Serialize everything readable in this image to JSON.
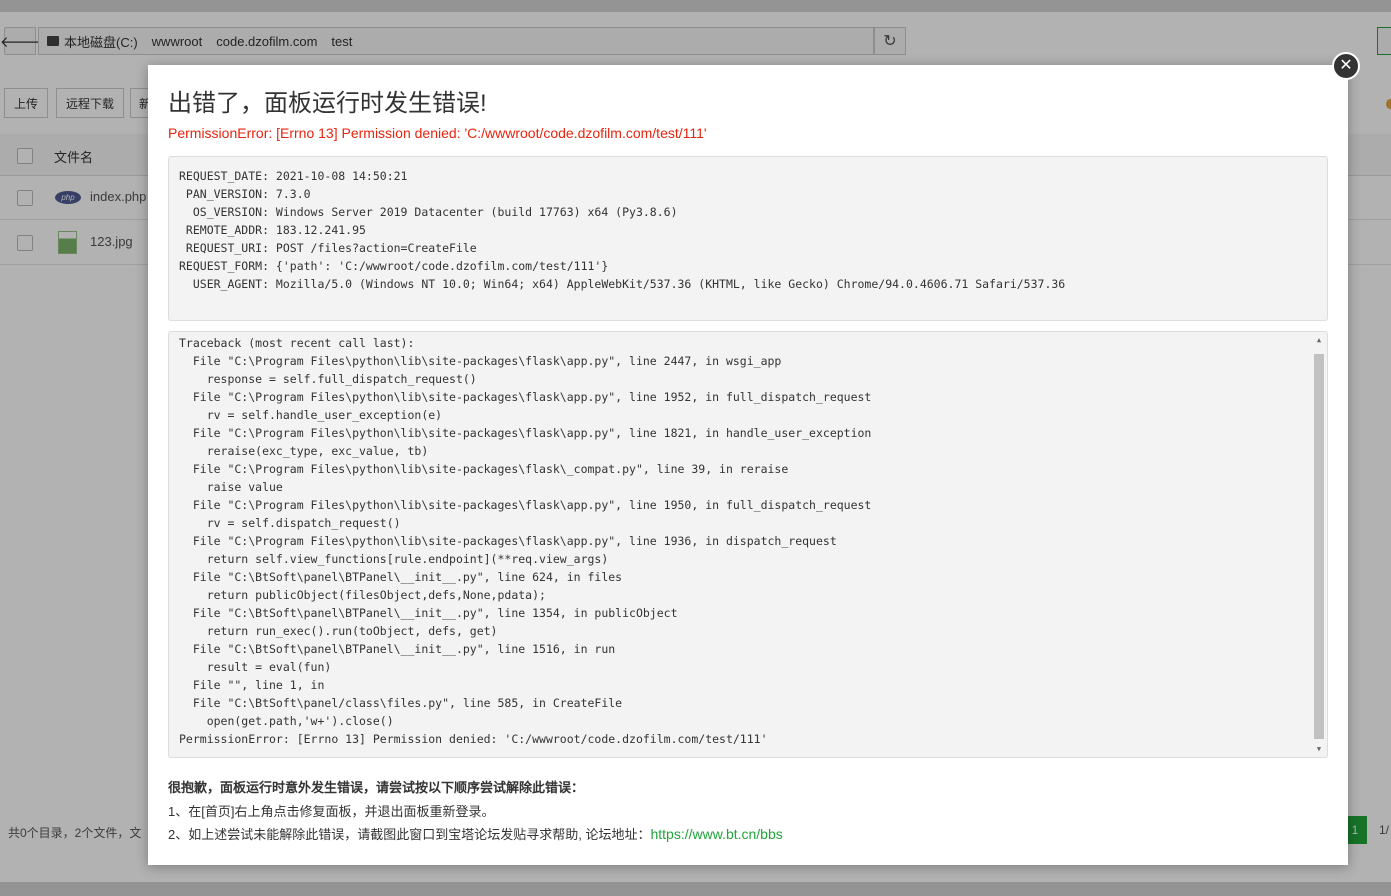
{
  "background": {
    "breadcrumb": [
      "本地磁盘(C:)",
      "wwwroot",
      "code.dzofilm.com",
      "test"
    ],
    "toolbar": {
      "upload": "上传",
      "remote_download": "远程下载",
      "new_partial": "新"
    },
    "table": {
      "header_name": "文件名",
      "rows": [
        {
          "name": "index.php",
          "icon": "php-file-icon"
        },
        {
          "name": "123.jpg",
          "icon": "image-file-icon"
        }
      ]
    },
    "footer_summary": "共0个目录，2个文件，文",
    "pagination": {
      "current": "1",
      "total_partial": "1/"
    }
  },
  "modal": {
    "title": "出错了，面板运行时发生错误!",
    "error": "PermissionError: [Errno 13] Permission denied: 'C:/wwwroot/code.dzofilm.com/test/111'",
    "info": [
      "REQUEST_DATE: 2021-10-08 14:50:21",
      " PAN_VERSION: 7.3.0",
      "  OS_VERSION: Windows Server 2019 Datacenter (build 17763) x64 (Py3.8.6)",
      " REMOTE_ADDR: 183.12.241.95",
      " REQUEST_URI: POST /files?action=CreateFile",
      "REQUEST_FORM: {'path': 'C:/wwwroot/code.dzofilm.com/test/111'}",
      "  USER_AGENT: Mozilla/5.0 (Windows NT 10.0; Win64; x64) AppleWebKit/537.36 (KHTML, like Gecko) Chrome/94.0.4606.71 Safari/537.36"
    ],
    "traceback": [
      "Traceback (most recent call last):",
      "  File \"C:\\Program Files\\python\\lib\\site-packages\\flask\\app.py\", line 2447, in wsgi_app",
      "    response = self.full_dispatch_request()",
      "  File \"C:\\Program Files\\python\\lib\\site-packages\\flask\\app.py\", line 1952, in full_dispatch_request",
      "    rv = self.handle_user_exception(e)",
      "  File \"C:\\Program Files\\python\\lib\\site-packages\\flask\\app.py\", line 1821, in handle_user_exception",
      "    reraise(exc_type, exc_value, tb)",
      "  File \"C:\\Program Files\\python\\lib\\site-packages\\flask\\_compat.py\", line 39, in reraise",
      "    raise value",
      "  File \"C:\\Program Files\\python\\lib\\site-packages\\flask\\app.py\", line 1950, in full_dispatch_request",
      "    rv = self.dispatch_request()",
      "  File \"C:\\Program Files\\python\\lib\\site-packages\\flask\\app.py\", line 1936, in dispatch_request",
      "    return self.view_functions[rule.endpoint](**req.view_args)",
      "  File \"C:\\BtSoft\\panel\\BTPanel\\__init__.py\", line 624, in files",
      "    return publicObject(filesObject,defs,None,pdata);",
      "  File \"C:\\BtSoft\\panel\\BTPanel\\__init__.py\", line 1354, in publicObject",
      "    return run_exec().run(toObject, defs, get)",
      "  File \"C:\\BtSoft\\panel\\BTPanel\\__init__.py\", line 1516, in run",
      "    result = eval(fun)",
      "  File \"\", line 1, in",
      "  File \"C:\\BtSoft\\panel/class\\files.py\", line 585, in CreateFile",
      "    open(get.path,'w+').close()",
      "PermissionError: [Errno 13] Permission denied: 'C:/wwwroot/code.dzofilm.com/test/111'"
    ],
    "help_title": "很抱歉，面板运行时意外发生错误，请尝试按以下顺序尝试解除此错误：",
    "help_step1": "1、在[首页]右上角点击修复面板，并退出面板重新登录。",
    "help_step2_prefix": "2、如上述尝试未能解除此错误，请截图此窗口到宝塔论坛发贴寻求帮助, 论坛地址：",
    "help_link": "https://www.bt.cn/bbs"
  },
  "colors": {
    "accent": "#20a53a",
    "error": "#e8240e"
  }
}
